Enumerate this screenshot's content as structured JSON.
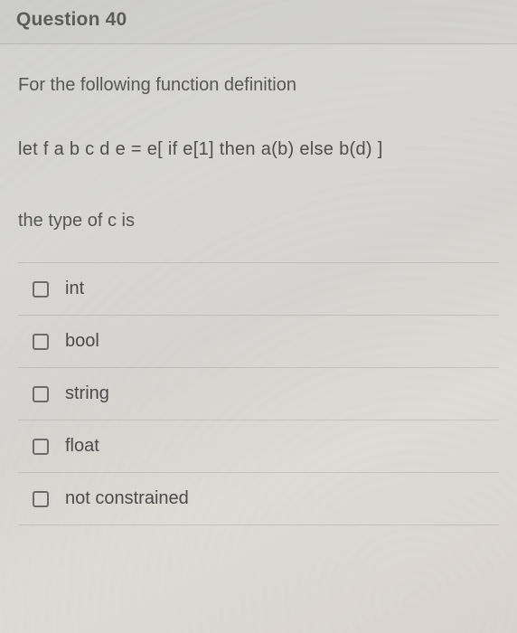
{
  "header": {
    "title": "Question 40"
  },
  "question": {
    "prompt": "For the following function definition",
    "code": "let f a b c d e = e[ if e[1] then a(b) else b(d)  ]",
    "sub": "the type of c is"
  },
  "options": [
    {
      "label": "int"
    },
    {
      "label": "bool"
    },
    {
      "label": "string"
    },
    {
      "label": "float"
    },
    {
      "label": "not constrained"
    }
  ]
}
